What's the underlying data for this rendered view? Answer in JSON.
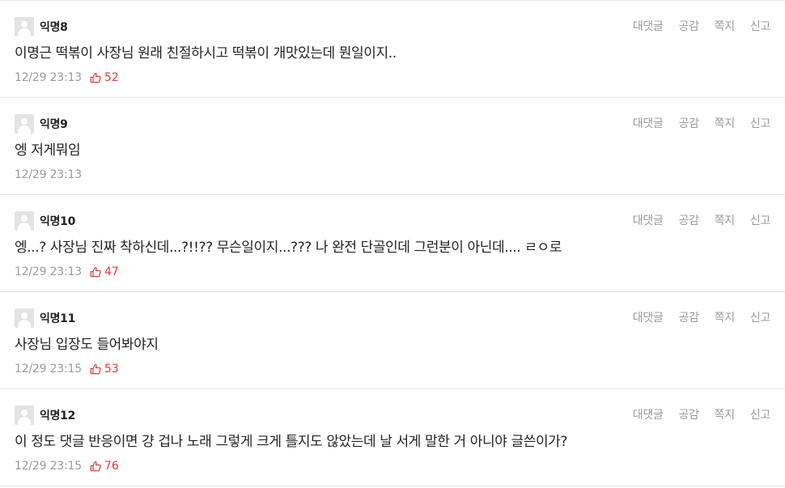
{
  "comments": [
    {
      "nickname": "익명8",
      "text": "이명근 떡볶이 사장님 원래 친절하시고 떡볶이 개맛있는데 뭔일이지..",
      "time": "12/29 23:13",
      "likes": "52",
      "actions": [
        "대댓글",
        "공감",
        "쪽지",
        "신고"
      ]
    },
    {
      "nickname": "익명9",
      "text": "엥 저게뭐임",
      "time": "12/29 23:13",
      "likes": "",
      "actions": [
        "대댓글",
        "공감",
        "쪽지",
        "신고"
      ]
    },
    {
      "nickname": "익명10",
      "text": "엥...? 사장님 진짜 착하신데...?!!?? 무슨일이지...??? 나 완전 단골인데 그런분이 아닌데.... ㄹㅇ로",
      "time": "12/29 23:13",
      "likes": "47",
      "actions": [
        "대댓글",
        "공감",
        "쪽지",
        "신고"
      ]
    },
    {
      "nickname": "익명11",
      "text": "사장님 입장도 들어봐야지",
      "time": "12/29 23:15",
      "likes": "53",
      "actions": [
        "대댓글",
        "공감",
        "쪽지",
        "신고"
      ]
    },
    {
      "nickname": "익명12",
      "text": "이 정도 댓글 반응이면 걍 겁나 노래 그렇게 크게 틀지도 않았는데 날 서게 말한 거 아니야 글쓴이가?",
      "time": "12/29 23:15",
      "likes": "76",
      "actions": [
        "대댓글",
        "공감",
        "쪽지",
        "신고"
      ]
    }
  ],
  "icons": {
    "avatar": "default-avatar-icon",
    "like": "thumbs-up-icon"
  },
  "colors": {
    "like": "#e03b3b",
    "muted": "#9a9a9a",
    "divider": "#e5e5e5",
    "avatar_bg": "#e3e3e3"
  }
}
